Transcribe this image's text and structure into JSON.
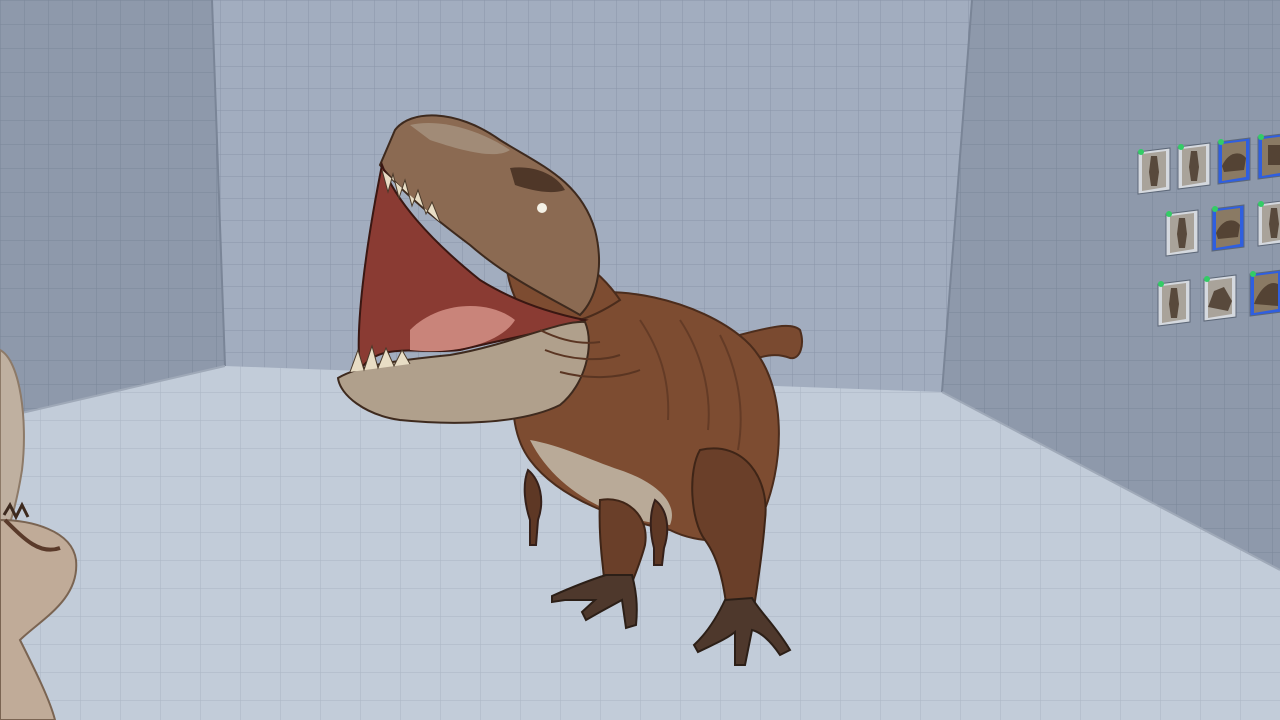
{
  "scene": {
    "environment": "grid-room",
    "wall_color": "#8e99ab",
    "back_wall_color": "#a2adbf",
    "floor_color": "#c2ccd9",
    "grid_line_color": "#7f8a9c"
  },
  "creature": {
    "kind": "tyrannosaurus",
    "pose": "roaring",
    "skin_color": "#7a4a30",
    "belly_color": "#b9aa98"
  },
  "thumbnail_panel": {
    "badge_color": "#33cc66",
    "selected_color": "#2f5fe0",
    "rows": [
      [
        {
          "icon": "tall-creature-thumb-icon",
          "selected": false
        },
        {
          "icon": "tall-creature-thumb-icon",
          "selected": false
        },
        {
          "icon": "dinosaur-thumb-icon",
          "selected": true
        },
        {
          "icon": "partial-thumb-icon",
          "selected": true
        }
      ],
      [
        {
          "icon": "tall-creature-thumb-icon",
          "selected": false
        },
        {
          "icon": "dinosaur-thumb-icon",
          "selected": true
        },
        {
          "icon": "tall-creature-thumb-icon",
          "selected": false
        }
      ],
      [
        {
          "icon": "tall-creature-thumb-icon",
          "selected": false
        },
        {
          "icon": "rock-creature-thumb-icon",
          "selected": false
        },
        {
          "icon": "claw-thumb-icon",
          "selected": true
        }
      ]
    ]
  }
}
